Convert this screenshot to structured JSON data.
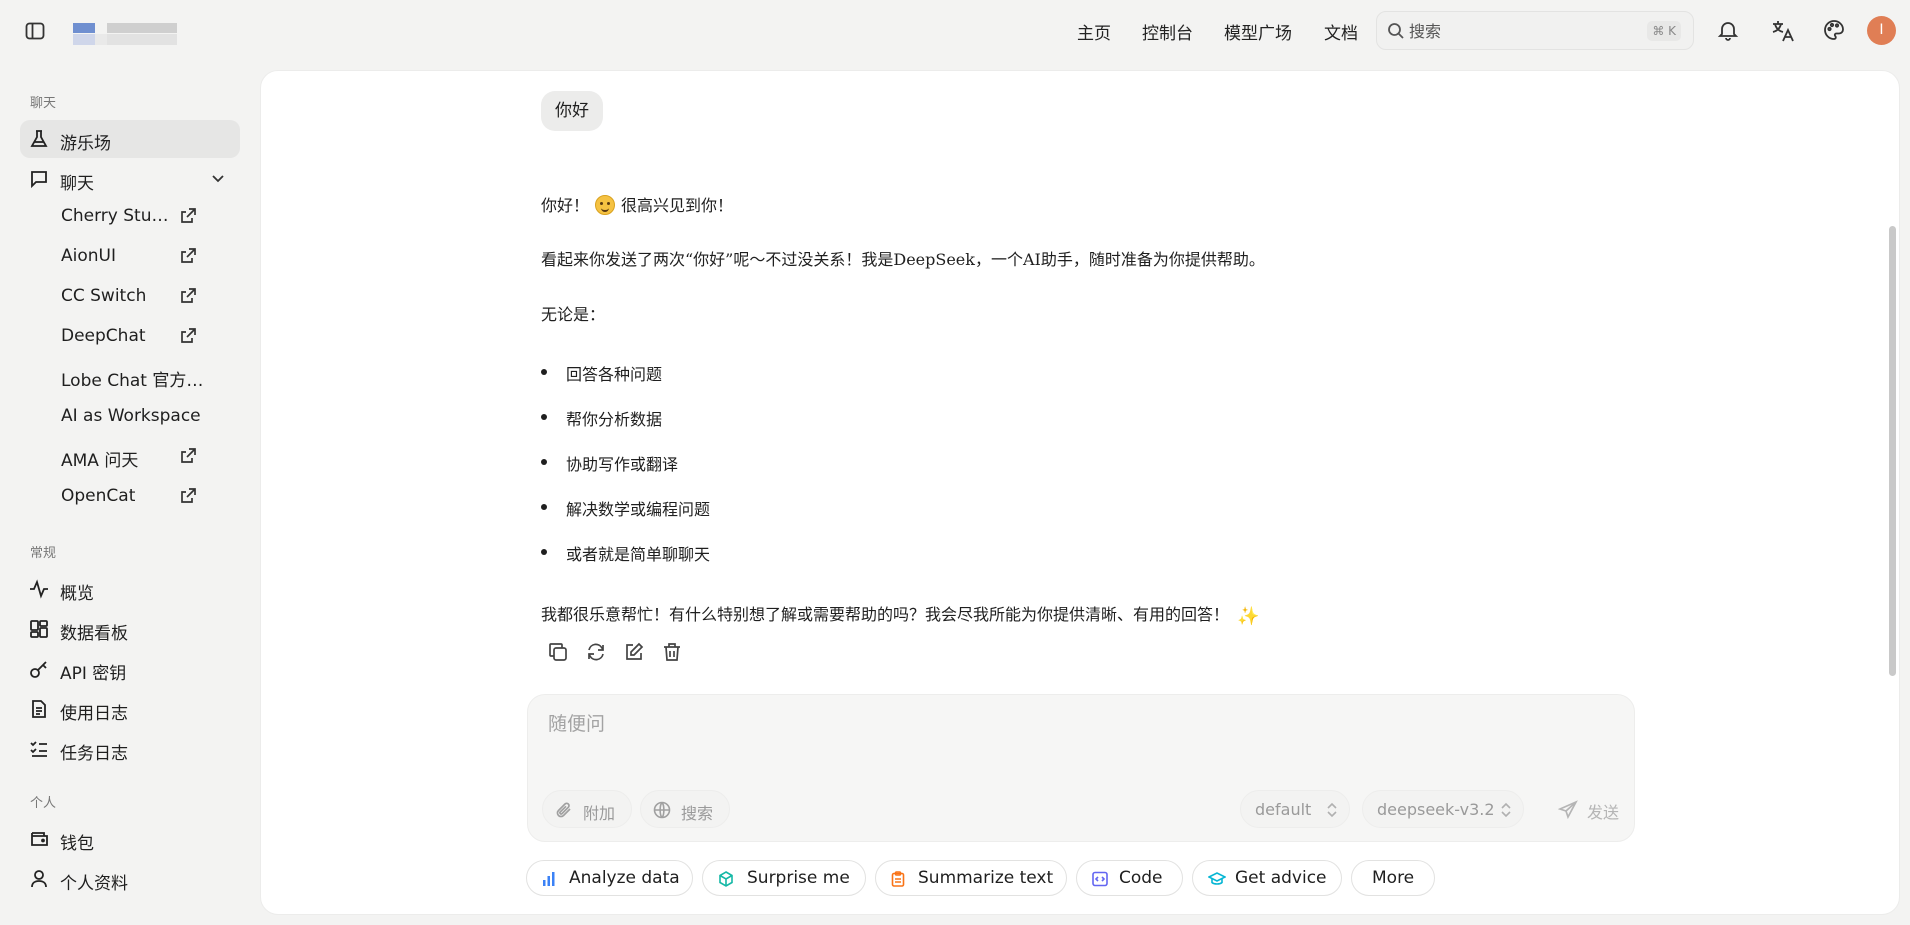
{
  "topbar": {
    "nav": [
      "主页",
      "控制台",
      "模型广场",
      "文档"
    ],
    "search_placeholder": "搜索",
    "search_shortcut": "⌘ K",
    "avatar_initial": "I",
    "avatar_color": "#e07e55"
  },
  "sidebar": {
    "section_chat": "聊天",
    "playground": "游乐场",
    "chat": "聊天",
    "chat_apps": [
      {
        "label": "Cherry Stu…",
        "external": true
      },
      {
        "label": "AionUI",
        "external": true
      },
      {
        "label": "CC Switch",
        "external": true
      },
      {
        "label": "DeepChat",
        "external": true
      },
      {
        "label": "Lobe Chat 官方…",
        "external": false
      },
      {
        "label": "AI as Workspace",
        "external": false
      },
      {
        "label": "AMA 问天",
        "external": true
      },
      {
        "label": "OpenCat",
        "external": true
      }
    ],
    "section_general": "常规",
    "general_items": [
      "概览",
      "数据看板",
      "API 密钥",
      "使用日志",
      "任务日志"
    ],
    "section_personal": "个人",
    "personal_items": [
      "钱包",
      "个人资料"
    ]
  },
  "conversation": {
    "user_message": "你好",
    "reply": {
      "greeting_before": "你好！",
      "greeting_after": "很高兴见到你！",
      "line2": "看起来你发送了两次“你好”呢～不过没关系！我是DeepSeek，一个AI助手，随时准备为你提供帮助。",
      "line3": "无论是：",
      "bullets": [
        "回答各种问题",
        "帮你分析数据",
        "协助写作或翻译",
        "解决数学或编程问题",
        "或者就是简单聊聊天"
      ],
      "closing": "我都很乐意帮忙！有什么特别想了解或需要帮助的吗？我会尽我所能为你提供清晰、有用的回答！"
    }
  },
  "composer": {
    "placeholder": "随便问",
    "attach_label": "附加",
    "search_label": "搜索",
    "group_value": "default",
    "model_value": "deepseek-v3.2",
    "send_label": "发送"
  },
  "suggestions": [
    {
      "label": "Analyze data",
      "icon": "bar-chart-icon",
      "color": "#3b82f6"
    },
    {
      "label": "Surprise me",
      "icon": "cube-icon",
      "color": "#14b8a6"
    },
    {
      "label": "Summarize text",
      "icon": "clipboard-icon",
      "color": "#f97316"
    },
    {
      "label": "Code",
      "icon": "code-icon",
      "color": "#6366f1"
    },
    {
      "label": "Get advice",
      "icon": "graduation-cap-icon",
      "color": "#06b6d4"
    },
    {
      "label": "More",
      "icon": "",
      "color": ""
    }
  ]
}
